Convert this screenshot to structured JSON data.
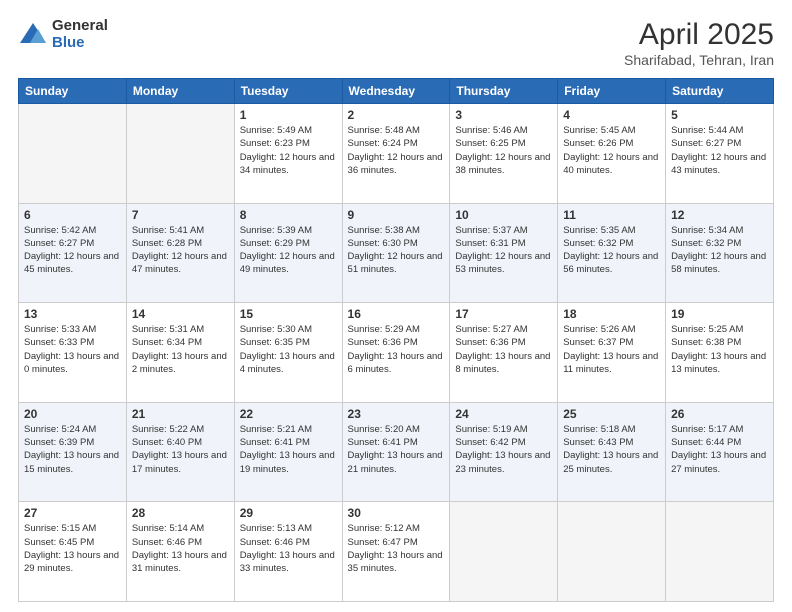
{
  "header": {
    "logo_general": "General",
    "logo_blue": "Blue",
    "title": "April 2025",
    "subtitle": "Sharifabad, Tehran, Iran"
  },
  "days_of_week": [
    "Sunday",
    "Monday",
    "Tuesday",
    "Wednesday",
    "Thursday",
    "Friday",
    "Saturday"
  ],
  "weeks": [
    [
      {
        "num": "",
        "info": ""
      },
      {
        "num": "",
        "info": ""
      },
      {
        "num": "1",
        "info": "Sunrise: 5:49 AM\nSunset: 6:23 PM\nDaylight: 12 hours and 34 minutes."
      },
      {
        "num": "2",
        "info": "Sunrise: 5:48 AM\nSunset: 6:24 PM\nDaylight: 12 hours and 36 minutes."
      },
      {
        "num": "3",
        "info": "Sunrise: 5:46 AM\nSunset: 6:25 PM\nDaylight: 12 hours and 38 minutes."
      },
      {
        "num": "4",
        "info": "Sunrise: 5:45 AM\nSunset: 6:26 PM\nDaylight: 12 hours and 40 minutes."
      },
      {
        "num": "5",
        "info": "Sunrise: 5:44 AM\nSunset: 6:27 PM\nDaylight: 12 hours and 43 minutes."
      }
    ],
    [
      {
        "num": "6",
        "info": "Sunrise: 5:42 AM\nSunset: 6:27 PM\nDaylight: 12 hours and 45 minutes."
      },
      {
        "num": "7",
        "info": "Sunrise: 5:41 AM\nSunset: 6:28 PM\nDaylight: 12 hours and 47 minutes."
      },
      {
        "num": "8",
        "info": "Sunrise: 5:39 AM\nSunset: 6:29 PM\nDaylight: 12 hours and 49 minutes."
      },
      {
        "num": "9",
        "info": "Sunrise: 5:38 AM\nSunset: 6:30 PM\nDaylight: 12 hours and 51 minutes."
      },
      {
        "num": "10",
        "info": "Sunrise: 5:37 AM\nSunset: 6:31 PM\nDaylight: 12 hours and 53 minutes."
      },
      {
        "num": "11",
        "info": "Sunrise: 5:35 AM\nSunset: 6:32 PM\nDaylight: 12 hours and 56 minutes."
      },
      {
        "num": "12",
        "info": "Sunrise: 5:34 AM\nSunset: 6:32 PM\nDaylight: 12 hours and 58 minutes."
      }
    ],
    [
      {
        "num": "13",
        "info": "Sunrise: 5:33 AM\nSunset: 6:33 PM\nDaylight: 13 hours and 0 minutes."
      },
      {
        "num": "14",
        "info": "Sunrise: 5:31 AM\nSunset: 6:34 PM\nDaylight: 13 hours and 2 minutes."
      },
      {
        "num": "15",
        "info": "Sunrise: 5:30 AM\nSunset: 6:35 PM\nDaylight: 13 hours and 4 minutes."
      },
      {
        "num": "16",
        "info": "Sunrise: 5:29 AM\nSunset: 6:36 PM\nDaylight: 13 hours and 6 minutes."
      },
      {
        "num": "17",
        "info": "Sunrise: 5:27 AM\nSunset: 6:36 PM\nDaylight: 13 hours and 8 minutes."
      },
      {
        "num": "18",
        "info": "Sunrise: 5:26 AM\nSunset: 6:37 PM\nDaylight: 13 hours and 11 minutes."
      },
      {
        "num": "19",
        "info": "Sunrise: 5:25 AM\nSunset: 6:38 PM\nDaylight: 13 hours and 13 minutes."
      }
    ],
    [
      {
        "num": "20",
        "info": "Sunrise: 5:24 AM\nSunset: 6:39 PM\nDaylight: 13 hours and 15 minutes."
      },
      {
        "num": "21",
        "info": "Sunrise: 5:22 AM\nSunset: 6:40 PM\nDaylight: 13 hours and 17 minutes."
      },
      {
        "num": "22",
        "info": "Sunrise: 5:21 AM\nSunset: 6:41 PM\nDaylight: 13 hours and 19 minutes."
      },
      {
        "num": "23",
        "info": "Sunrise: 5:20 AM\nSunset: 6:41 PM\nDaylight: 13 hours and 21 minutes."
      },
      {
        "num": "24",
        "info": "Sunrise: 5:19 AM\nSunset: 6:42 PM\nDaylight: 13 hours and 23 minutes."
      },
      {
        "num": "25",
        "info": "Sunrise: 5:18 AM\nSunset: 6:43 PM\nDaylight: 13 hours and 25 minutes."
      },
      {
        "num": "26",
        "info": "Sunrise: 5:17 AM\nSunset: 6:44 PM\nDaylight: 13 hours and 27 minutes."
      }
    ],
    [
      {
        "num": "27",
        "info": "Sunrise: 5:15 AM\nSunset: 6:45 PM\nDaylight: 13 hours and 29 minutes."
      },
      {
        "num": "28",
        "info": "Sunrise: 5:14 AM\nSunset: 6:46 PM\nDaylight: 13 hours and 31 minutes."
      },
      {
        "num": "29",
        "info": "Sunrise: 5:13 AM\nSunset: 6:46 PM\nDaylight: 13 hours and 33 minutes."
      },
      {
        "num": "30",
        "info": "Sunrise: 5:12 AM\nSunset: 6:47 PM\nDaylight: 13 hours and 35 minutes."
      },
      {
        "num": "",
        "info": ""
      },
      {
        "num": "",
        "info": ""
      },
      {
        "num": "",
        "info": ""
      }
    ]
  ]
}
